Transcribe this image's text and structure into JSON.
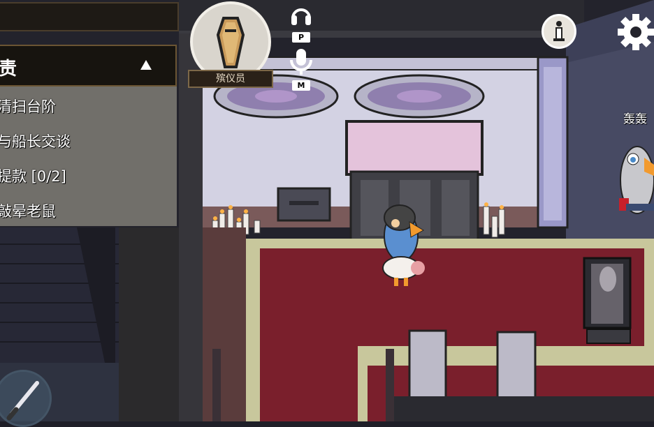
{
  "hud": {
    "tasks": {
      "title": "责",
      "items": [
        "清扫台阶",
        "与船长交谈",
        "提款 [0/2]",
        "敲晕老鼠"
      ]
    },
    "role": {
      "label": "殡仪员",
      "icon": "coffin-icon"
    },
    "voice": {
      "headphones_icon": "headphones-icon",
      "headphones_key": "P",
      "mic_icon": "microphone-icon",
      "mic_key": "M"
    },
    "info_icon": "info-icon",
    "settings_icon": "gear-icon",
    "weapon_icon": "knife-icon",
    "other_player_name": "轰轰"
  },
  "colors": {
    "carpet": "#7a1f2c",
    "carpet_border": "#c8c79c",
    "wall": "#cfcde0",
    "panel_dark": "#17140f",
    "task_panel": "#787670"
  }
}
